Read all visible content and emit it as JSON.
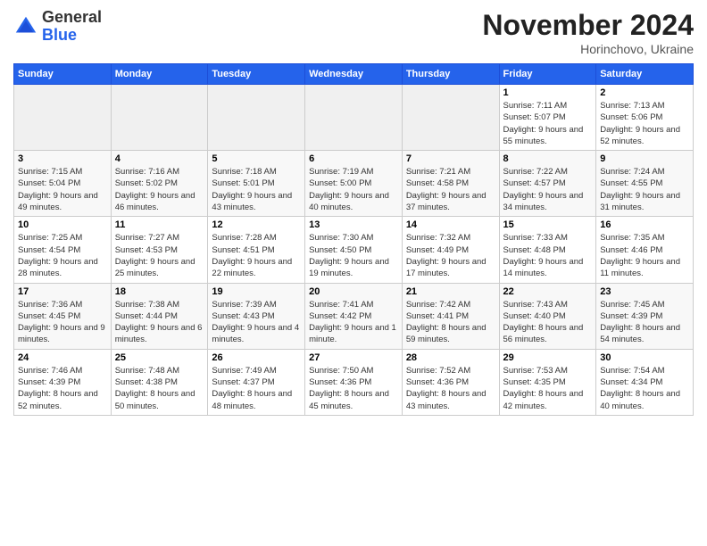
{
  "logo": {
    "general": "General",
    "blue": "Blue"
  },
  "header": {
    "month": "November 2024",
    "location": "Horinchovo, Ukraine"
  },
  "weekdays": [
    "Sunday",
    "Monday",
    "Tuesday",
    "Wednesday",
    "Thursday",
    "Friday",
    "Saturday"
  ],
  "weeks": [
    [
      {
        "day": "",
        "sunrise": "",
        "sunset": "",
        "daylight": ""
      },
      {
        "day": "",
        "sunrise": "",
        "sunset": "",
        "daylight": ""
      },
      {
        "day": "",
        "sunrise": "",
        "sunset": "",
        "daylight": ""
      },
      {
        "day": "",
        "sunrise": "",
        "sunset": "",
        "daylight": ""
      },
      {
        "day": "",
        "sunrise": "",
        "sunset": "",
        "daylight": ""
      },
      {
        "day": "1",
        "sunrise": "Sunrise: 7:11 AM",
        "sunset": "Sunset: 5:07 PM",
        "daylight": "Daylight: 9 hours and 55 minutes."
      },
      {
        "day": "2",
        "sunrise": "Sunrise: 7:13 AM",
        "sunset": "Sunset: 5:06 PM",
        "daylight": "Daylight: 9 hours and 52 minutes."
      }
    ],
    [
      {
        "day": "3",
        "sunrise": "Sunrise: 7:15 AM",
        "sunset": "Sunset: 5:04 PM",
        "daylight": "Daylight: 9 hours and 49 minutes."
      },
      {
        "day": "4",
        "sunrise": "Sunrise: 7:16 AM",
        "sunset": "Sunset: 5:02 PM",
        "daylight": "Daylight: 9 hours and 46 minutes."
      },
      {
        "day": "5",
        "sunrise": "Sunrise: 7:18 AM",
        "sunset": "Sunset: 5:01 PM",
        "daylight": "Daylight: 9 hours and 43 minutes."
      },
      {
        "day": "6",
        "sunrise": "Sunrise: 7:19 AM",
        "sunset": "Sunset: 5:00 PM",
        "daylight": "Daylight: 9 hours and 40 minutes."
      },
      {
        "day": "7",
        "sunrise": "Sunrise: 7:21 AM",
        "sunset": "Sunset: 4:58 PM",
        "daylight": "Daylight: 9 hours and 37 minutes."
      },
      {
        "day": "8",
        "sunrise": "Sunrise: 7:22 AM",
        "sunset": "Sunset: 4:57 PM",
        "daylight": "Daylight: 9 hours and 34 minutes."
      },
      {
        "day": "9",
        "sunrise": "Sunrise: 7:24 AM",
        "sunset": "Sunset: 4:55 PM",
        "daylight": "Daylight: 9 hours and 31 minutes."
      }
    ],
    [
      {
        "day": "10",
        "sunrise": "Sunrise: 7:25 AM",
        "sunset": "Sunset: 4:54 PM",
        "daylight": "Daylight: 9 hours and 28 minutes."
      },
      {
        "day": "11",
        "sunrise": "Sunrise: 7:27 AM",
        "sunset": "Sunset: 4:53 PM",
        "daylight": "Daylight: 9 hours and 25 minutes."
      },
      {
        "day": "12",
        "sunrise": "Sunrise: 7:28 AM",
        "sunset": "Sunset: 4:51 PM",
        "daylight": "Daylight: 9 hours and 22 minutes."
      },
      {
        "day": "13",
        "sunrise": "Sunrise: 7:30 AM",
        "sunset": "Sunset: 4:50 PM",
        "daylight": "Daylight: 9 hours and 19 minutes."
      },
      {
        "day": "14",
        "sunrise": "Sunrise: 7:32 AM",
        "sunset": "Sunset: 4:49 PM",
        "daylight": "Daylight: 9 hours and 17 minutes."
      },
      {
        "day": "15",
        "sunrise": "Sunrise: 7:33 AM",
        "sunset": "Sunset: 4:48 PM",
        "daylight": "Daylight: 9 hours and 14 minutes."
      },
      {
        "day": "16",
        "sunrise": "Sunrise: 7:35 AM",
        "sunset": "Sunset: 4:46 PM",
        "daylight": "Daylight: 9 hours and 11 minutes."
      }
    ],
    [
      {
        "day": "17",
        "sunrise": "Sunrise: 7:36 AM",
        "sunset": "Sunset: 4:45 PM",
        "daylight": "Daylight: 9 hours and 9 minutes."
      },
      {
        "day": "18",
        "sunrise": "Sunrise: 7:38 AM",
        "sunset": "Sunset: 4:44 PM",
        "daylight": "Daylight: 9 hours and 6 minutes."
      },
      {
        "day": "19",
        "sunrise": "Sunrise: 7:39 AM",
        "sunset": "Sunset: 4:43 PM",
        "daylight": "Daylight: 9 hours and 4 minutes."
      },
      {
        "day": "20",
        "sunrise": "Sunrise: 7:41 AM",
        "sunset": "Sunset: 4:42 PM",
        "daylight": "Daylight: 9 hours and 1 minute."
      },
      {
        "day": "21",
        "sunrise": "Sunrise: 7:42 AM",
        "sunset": "Sunset: 4:41 PM",
        "daylight": "Daylight: 8 hours and 59 minutes."
      },
      {
        "day": "22",
        "sunrise": "Sunrise: 7:43 AM",
        "sunset": "Sunset: 4:40 PM",
        "daylight": "Daylight: 8 hours and 56 minutes."
      },
      {
        "day": "23",
        "sunrise": "Sunrise: 7:45 AM",
        "sunset": "Sunset: 4:39 PM",
        "daylight": "Daylight: 8 hours and 54 minutes."
      }
    ],
    [
      {
        "day": "24",
        "sunrise": "Sunrise: 7:46 AM",
        "sunset": "Sunset: 4:39 PM",
        "daylight": "Daylight: 8 hours and 52 minutes."
      },
      {
        "day": "25",
        "sunrise": "Sunrise: 7:48 AM",
        "sunset": "Sunset: 4:38 PM",
        "daylight": "Daylight: 8 hours and 50 minutes."
      },
      {
        "day": "26",
        "sunrise": "Sunrise: 7:49 AM",
        "sunset": "Sunset: 4:37 PM",
        "daylight": "Daylight: 8 hours and 48 minutes."
      },
      {
        "day": "27",
        "sunrise": "Sunrise: 7:50 AM",
        "sunset": "Sunset: 4:36 PM",
        "daylight": "Daylight: 8 hours and 45 minutes."
      },
      {
        "day": "28",
        "sunrise": "Sunrise: 7:52 AM",
        "sunset": "Sunset: 4:36 PM",
        "daylight": "Daylight: 8 hours and 43 minutes."
      },
      {
        "day": "29",
        "sunrise": "Sunrise: 7:53 AM",
        "sunset": "Sunset: 4:35 PM",
        "daylight": "Daylight: 8 hours and 42 minutes."
      },
      {
        "day": "30",
        "sunrise": "Sunrise: 7:54 AM",
        "sunset": "Sunset: 4:34 PM",
        "daylight": "Daylight: 8 hours and 40 minutes."
      }
    ]
  ]
}
